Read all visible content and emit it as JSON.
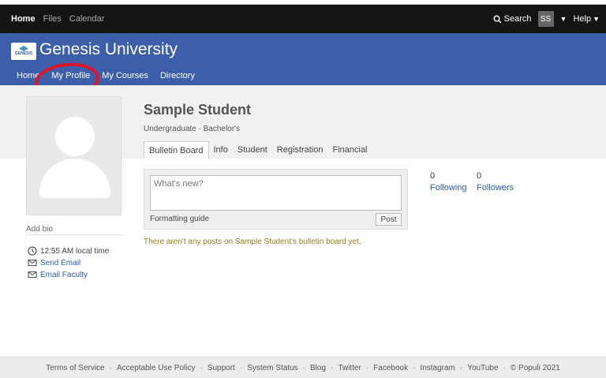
{
  "topbar": {
    "links": [
      "Home",
      "Files",
      "Calendar"
    ],
    "search_label": "Search",
    "user_initials": "SS",
    "help_label": "Help"
  },
  "header": {
    "logo_text": "GENESIS",
    "title": "Genesis University",
    "nav": [
      "Home",
      "My Profile",
      "My Courses",
      "Directory"
    ]
  },
  "profile": {
    "name": "Sample Student",
    "degree": "Undergraduate · Bachelor's",
    "tabs": [
      "Bulletin Board",
      "Info",
      "Student",
      "Registration",
      "Financial"
    ],
    "add_bio": "Add bio",
    "local_time": "12:55 AM local time",
    "send_email": "Send Email",
    "email_faculty": "Email Faculty"
  },
  "bulletin": {
    "placeholder": "What's new?",
    "formatting_guide": "Formatting guide",
    "post_label": "Post",
    "empty_message": "There aren't any posts on Sample Student's bulletin board yet."
  },
  "stats": {
    "following_count": "0",
    "following_label": "Following",
    "followers_count": "0",
    "followers_label": "Followers"
  },
  "footer": {
    "links": [
      "Terms of Service",
      "Acceptable Use Policy",
      "Support",
      "System Status",
      "Blog",
      "Twitter",
      "Facebook",
      "Instagram",
      "YouTube",
      "© Populi 2021"
    ]
  },
  "colors": {
    "brand_blue": "#3d5ea8",
    "annotation_red": "#e0142a",
    "link_blue": "#2d5fa8"
  }
}
